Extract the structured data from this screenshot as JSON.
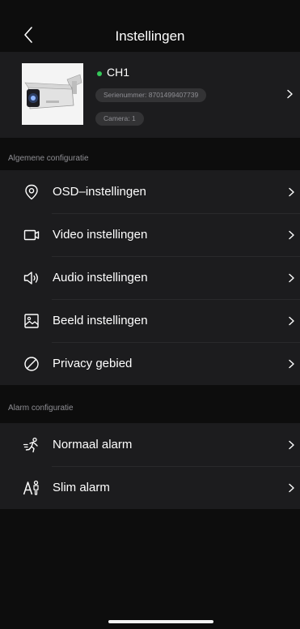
{
  "header": {
    "title": "Instellingen"
  },
  "device": {
    "name": "CH1",
    "serial": "Serienummer: 8701499407739",
    "camera": "Camera: 1",
    "status_color": "#35c85a"
  },
  "sections": {
    "general": {
      "label": "Algemene configuratie",
      "items": [
        {
          "label": "OSD–instellingen",
          "icon": "location-pin-icon"
        },
        {
          "label": "Video instellingen",
          "icon": "video-camera-icon"
        },
        {
          "label": "Audio instellingen",
          "icon": "speaker-icon"
        },
        {
          "label": "Beeld instellingen",
          "icon": "image-icon"
        },
        {
          "label": "Privacy gebied",
          "icon": "prohibited-icon"
        }
      ]
    },
    "alarm": {
      "label": "Alarm configuratie",
      "items": [
        {
          "label": "Normaal alarm",
          "icon": "running-person-icon"
        },
        {
          "label": "Slim alarm",
          "icon": "smart-person-icon"
        }
      ]
    }
  }
}
